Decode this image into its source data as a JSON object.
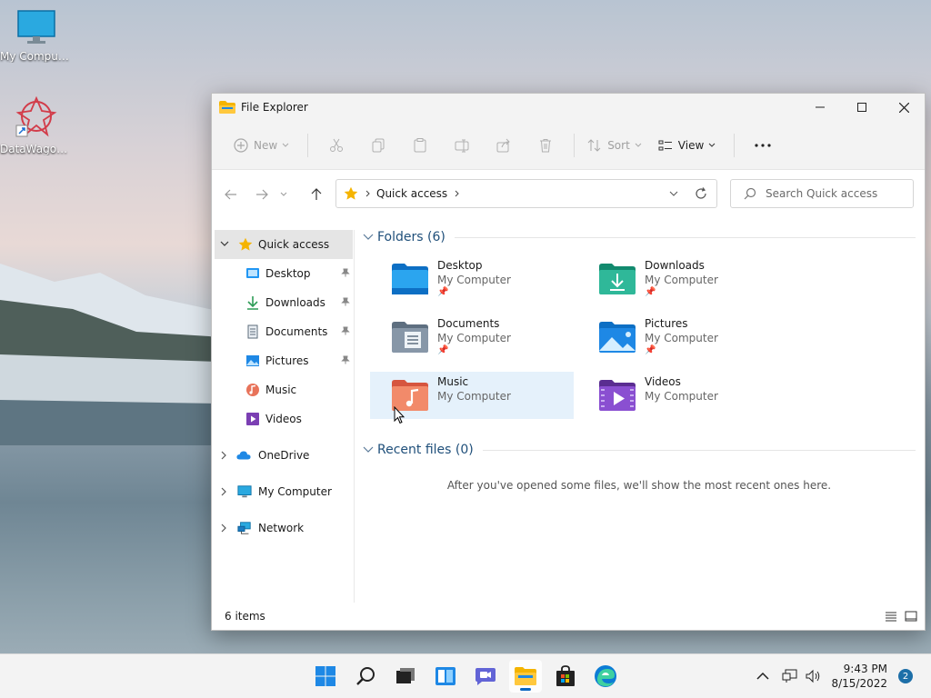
{
  "desktop": {
    "icons": [
      {
        "label": "My Computer"
      },
      {
        "label": "DataWagon..."
      }
    ]
  },
  "window": {
    "title": "File Explorer",
    "commands": {
      "new": "New",
      "sort": "Sort",
      "view": "View"
    },
    "address": {
      "crumb": "Quick access"
    },
    "search": {
      "placeholder": "Search Quick access"
    },
    "sidebar": {
      "items": [
        {
          "label": "Quick access"
        },
        {
          "label": "Desktop"
        },
        {
          "label": "Downloads"
        },
        {
          "label": "Documents"
        },
        {
          "label": "Pictures"
        },
        {
          "label": "Music"
        },
        {
          "label": "Videos"
        },
        {
          "label": "OneDrive"
        },
        {
          "label": "My Computer"
        },
        {
          "label": "Network"
        }
      ]
    },
    "folders_header": "Folders (6)",
    "folders": [
      {
        "name": "Desktop",
        "location": "My Computer"
      },
      {
        "name": "Downloads",
        "location": "My Computer"
      },
      {
        "name": "Documents",
        "location": "My Computer"
      },
      {
        "name": "Pictures",
        "location": "My Computer"
      },
      {
        "name": "Music",
        "location": "My Computer"
      },
      {
        "name": "Videos",
        "location": "My Computer"
      }
    ],
    "recent_header": "Recent files (0)",
    "recent_empty": "After you've opened some files, we'll show the most recent ones here.",
    "status": "6 items"
  },
  "taskbar": {
    "time": "9:43 PM",
    "date": "8/15/2022",
    "notifications": "2"
  },
  "colors": {
    "accent": "#0a67c2",
    "folder_blue": "#1e88e5",
    "folder_teal": "#26a69a",
    "hover": "#e5f1fb"
  }
}
